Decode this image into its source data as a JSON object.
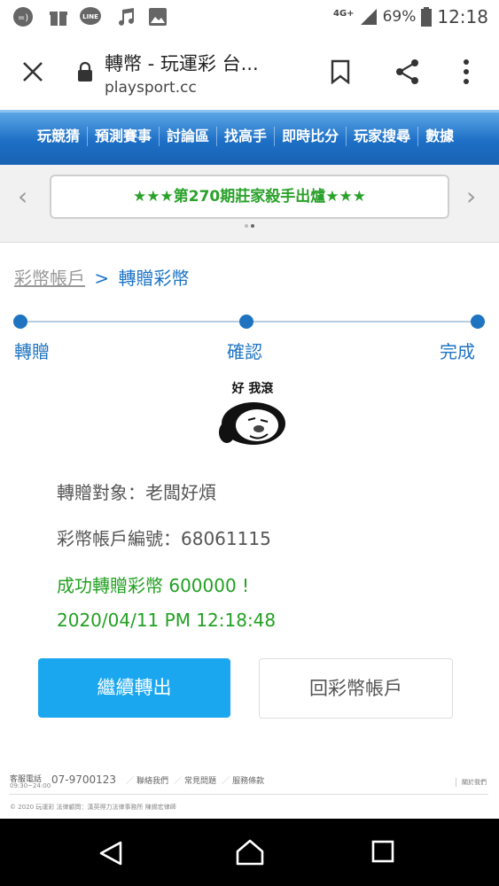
{
  "status_bar": {
    "network": "4G+",
    "battery_percent": "69%",
    "time": "12:18",
    "icons": [
      "messenger-icon",
      "gift-icon",
      "line-app-icon",
      "music-icon",
      "image-icon",
      "signal-icon",
      "battery-icon"
    ]
  },
  "browser": {
    "page_title": "轉幣 - 玩運彩 台...",
    "host": "playsport.cc",
    "icons": [
      "close-icon",
      "lock-icon",
      "bookmark-icon",
      "share-icon",
      "more-icon"
    ]
  },
  "site_nav": {
    "items": [
      "玩競猜",
      "預測賽事",
      "討論區",
      "找高手",
      "即時比分",
      "玩家搜尋",
      "數據"
    ]
  },
  "banner": {
    "text": "★★★第270期莊家殺手出爐★★★"
  },
  "breadcrumb": {
    "root": "彩幣帳戶",
    "separator": ">",
    "current": "轉贈彩幣"
  },
  "steps": {
    "items": [
      "轉贈",
      "確認",
      "完成"
    ]
  },
  "sticker": {
    "caption": "好 我滾"
  },
  "result": {
    "recipient_line": "轉贈對象：老闆好煩",
    "account_line": "彩幣帳戶編號：68061115",
    "success_line": "成功轉贈彩幣 600000 !",
    "timestamp": "2020/04/11 PM 12:18:48"
  },
  "actions": {
    "continue_label": "繼續轉出",
    "back_label": "回彩幣帳戶"
  },
  "footer": {
    "service_label": "客服電話",
    "service_hours": "09:30~24:00",
    "phone": "07-9700123",
    "links": [
      "聯絡我們",
      "常見問題",
      "服務條款"
    ],
    "close_label": "關於我們",
    "copyright": "© 2020 玩運彩 法律顧問：漢英得力法律事務所 陳錫宏律師"
  },
  "colors": {
    "nav_blue": "#1d6fc6",
    "link_blue": "#1f74c1",
    "success_green": "#22a022",
    "button_blue": "#1aa7f0"
  }
}
